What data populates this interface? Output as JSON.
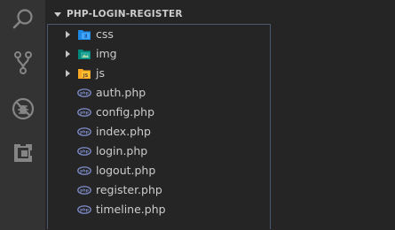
{
  "explorer": {
    "section_title": "PHP-LOGIN-REGISTER",
    "folders": [
      {
        "label": "css",
        "icon": "css-folder-icon"
      },
      {
        "label": "img",
        "icon": "image-folder-icon"
      },
      {
        "label": "js",
        "icon": "js-folder-icon"
      }
    ],
    "files": [
      {
        "label": "auth.php",
        "icon": "php-file-icon"
      },
      {
        "label": "config.php",
        "icon": "php-file-icon"
      },
      {
        "label": "index.php",
        "icon": "php-file-icon"
      },
      {
        "label": "login.php",
        "icon": "php-file-icon"
      },
      {
        "label": "logout.php",
        "icon": "php-file-icon"
      },
      {
        "label": "register.php",
        "icon": "php-file-icon"
      },
      {
        "label": "timeline.php",
        "icon": "php-file-icon"
      }
    ]
  },
  "activity_bar": {
    "items": [
      {
        "icon": "search-icon"
      },
      {
        "icon": "source-control-icon"
      },
      {
        "icon": "debug-icon"
      },
      {
        "icon": "extensions-icon"
      }
    ]
  },
  "colors": {
    "activity_bar": "#333333",
    "sidebar": "#252526",
    "text": "#cccccc",
    "css_icon": "#42a5f5",
    "img_icon": "#26a69a",
    "js_icon": "#fbc02d",
    "php_icon": "#7b88c3"
  }
}
